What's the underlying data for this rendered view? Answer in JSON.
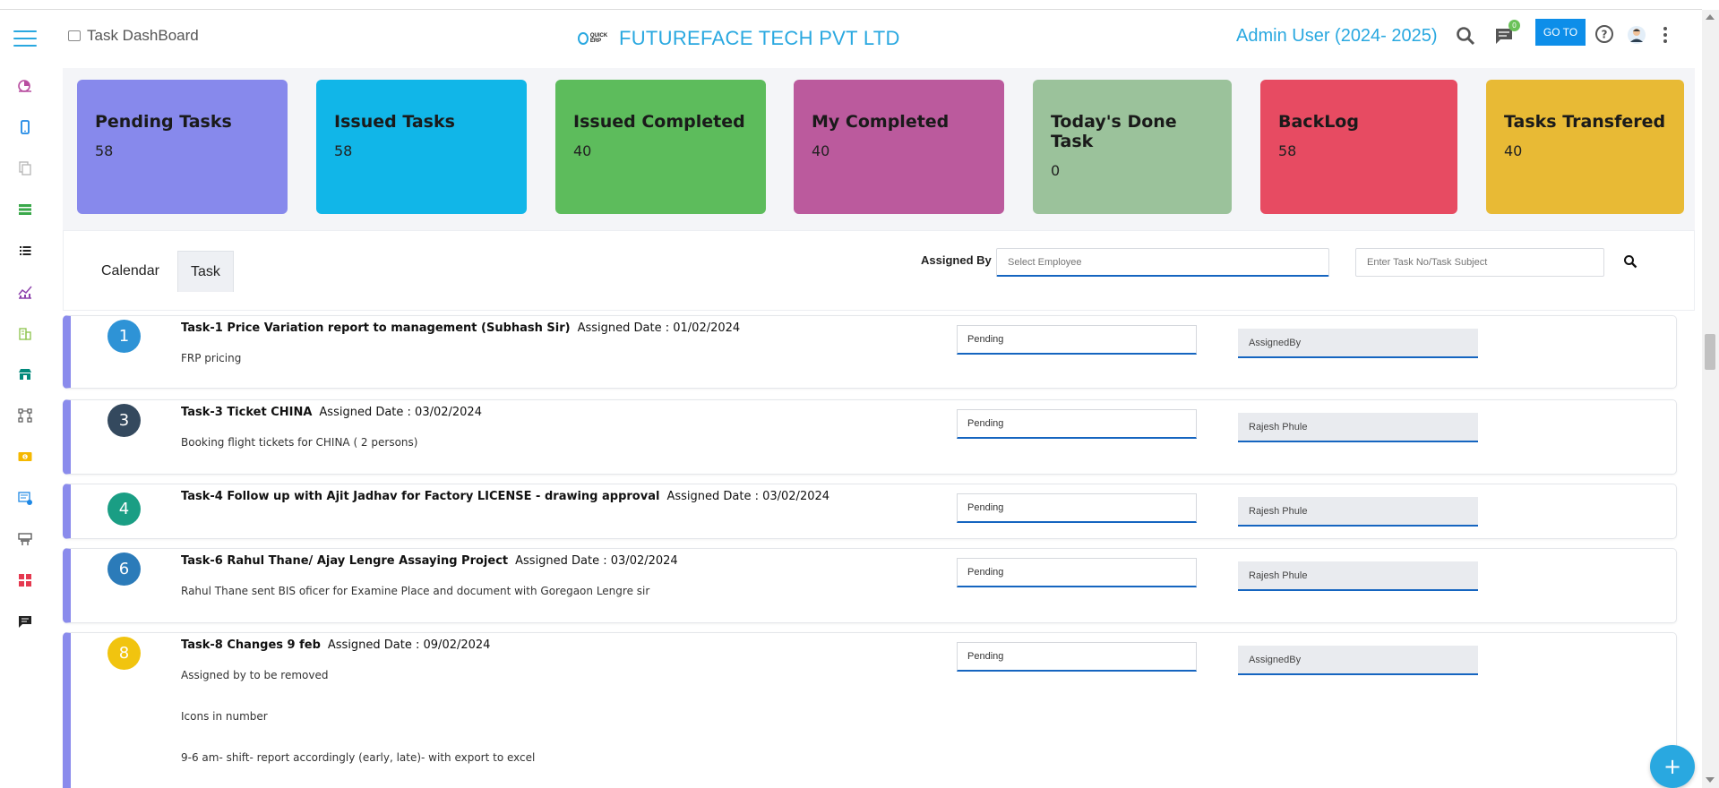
{
  "header": {
    "page_title": "Task DashBoard",
    "company": "FUTUREFACE TECH PVT LTD",
    "logo_text": "QUICK ERP",
    "admin": "Admin User (2024- 2025)",
    "notification_count": "0",
    "goto_label": "GO TO"
  },
  "cards": [
    {
      "title": "Pending Tasks",
      "count": "58",
      "color": "#8789ec"
    },
    {
      "title": "Issued Tasks",
      "count": "58",
      "color": "#11b6e8"
    },
    {
      "title": "Issued Completed",
      "count": "40",
      "color": "#5dbc5c"
    },
    {
      "title": "My Completed",
      "count": "40",
      "color": "#bb5a9d"
    },
    {
      "title": "Today's Done Task",
      "count": "0",
      "color": "#9bc29b"
    },
    {
      "title": "BackLog",
      "count": "58",
      "color": "#e74b62"
    },
    {
      "title": "Tasks Transfered",
      "count": "40",
      "color": "#e8ba35"
    }
  ],
  "filter": {
    "tabs": [
      "Calendar",
      "Task"
    ],
    "assigned_by_label": "Assigned By",
    "employee_placeholder": "Select Employee",
    "search_placeholder": "Enter Task No/Task Subject"
  },
  "tasks": [
    {
      "num": "1",
      "color": "#2e93d6",
      "title": "Task-1 Price Variation report to management (Subhash Sir)",
      "date": "Assigned Date : 01/02/2024",
      "desc": [
        "FRP pricing"
      ],
      "status": "Pending",
      "assignee": "AssignedBy"
    },
    {
      "num": "3",
      "color": "#34495e",
      "title": "Task-3 Ticket CHINA",
      "date": "Assigned Date : 03/02/2024",
      "desc": [
        "Booking flight tickets for CHINA ( 2 persons)"
      ],
      "status": "Pending",
      "assignee": "Rajesh Phule"
    },
    {
      "num": "4",
      "color": "#1a9e84",
      "title": "Task-4 Follow up with Ajit Jadhav for Factory LICENSE - drawing approval",
      "date": "Assigned Date : 03/02/2024",
      "desc": [],
      "status": "Pending",
      "assignee": "Rajesh Phule"
    },
    {
      "num": "6",
      "color": "#2b7bb9",
      "title": "Task-6 Rahul Thane/ Ajay Lengre Assaying Project",
      "date": "Assigned Date : 03/02/2024",
      "desc": [
        "Rahul Thane sent BIS oficer for Examine Place and document with Goregaon Lengre sir"
      ],
      "status": "Pending",
      "assignee": "Rajesh Phule"
    },
    {
      "num": "8",
      "color": "#f1c40f",
      "title": "Task-8 Changes 9 feb",
      "date": "Assigned Date : 09/02/2024",
      "desc": [
        "Assigned by to be removed",
        "Icons in number",
        "9-6 am- shift- report accordingly (early, late)- with export to excel"
      ],
      "status": "Pending",
      "assignee": "AssignedBy"
    }
  ],
  "sidebar_icons": [
    "pie-chart-icon",
    "mobile-icon",
    "documents-icon",
    "ledger-icon",
    "list-icon",
    "analytics-icon",
    "building-icon",
    "store-icon",
    "network-icon",
    "cash-icon",
    "billing-icon",
    "machine-icon",
    "apps-icon",
    "chat-icon"
  ],
  "fab_label": "+"
}
